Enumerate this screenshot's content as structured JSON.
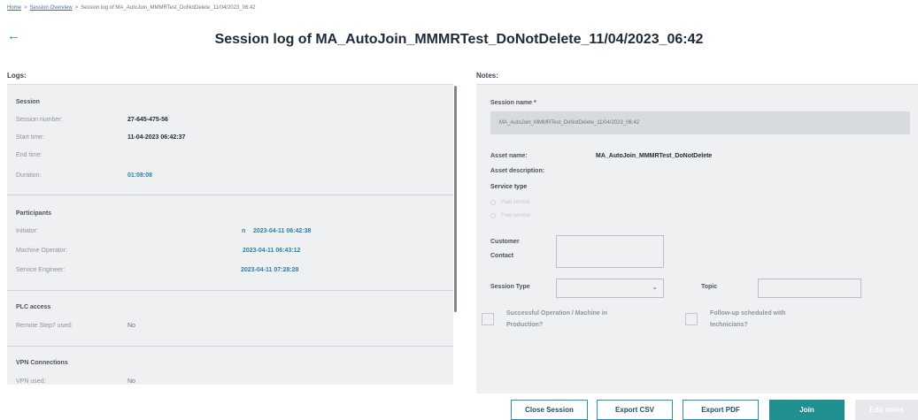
{
  "breadcrumb": {
    "home": "Home",
    "overview": "Session Overview",
    "current": "Session log of MA_AutoJoin_MMMRTest_DoNotDelete_11/04/2023_06:42"
  },
  "header": {
    "back_icon": "arrow-left-icon",
    "title": "Session log of MA_AutoJoin_MMMRTest_DoNotDelete_11/04/2023_06:42"
  },
  "logs": {
    "section_label": "Logs:",
    "session": {
      "title": "Session",
      "number_label": "Session number:",
      "number_value": "27-645-475-56",
      "start_label": "Start time:",
      "start_value": "11-04-2023 06:42:37",
      "end_label": "End time:",
      "end_value": "",
      "duration_label": "Duration:",
      "duration_value": "01:08:08"
    },
    "participants": {
      "title": "Participants",
      "items": [
        {
          "label": "Initiator:",
          "prefix": "n",
          "value": "2023-04-11 06:42:38"
        },
        {
          "label": "Machine Operator:",
          "prefix": "",
          "value": "2023-04-11 06:43:12"
        },
        {
          "label": "Service Engineer:",
          "prefix": "",
          "value": "2023-04-11 07:28:28"
        }
      ]
    },
    "plc": {
      "title": "PLC access",
      "label": "Remote Step7 used:",
      "value": "No"
    },
    "vpn": {
      "title": "VPN Connections",
      "label": "VPN used:",
      "value": "No"
    }
  },
  "notes": {
    "section_label": "Notes:",
    "session_name_label": "Session name *",
    "session_name_value": "MA_AutoJoin_MMMRTest_DoNotDelete_11/04/2023_06:42",
    "asset_name_label": "Asset name:",
    "asset_name_value": "MA_AutoJoin_MMMRTest_DoNotDelete",
    "asset_description_label": "Asset description:",
    "service_type_label": "Service type",
    "service_options": [
      "Paid service",
      "Free service"
    ],
    "customer_contact_label_1": "Customer",
    "customer_contact_label_2": "Contact",
    "session_type_label": "Session Type",
    "session_type_value": "",
    "topic_label": "Topic",
    "topic_value": "",
    "checkbox_successful_1": "Successful Operation / Machine in",
    "checkbox_successful_2": "Production?",
    "checkbox_followup_1": "Follow-up scheduled with",
    "checkbox_followup_2": "technicians?"
  },
  "buttons": {
    "close_session": "Close Session",
    "export_csv": "Export CSV",
    "export_pdf": "Export PDF",
    "join": "Join",
    "edit_notes": "Edit notes"
  },
  "colors": {
    "accent": "#2a8fb0",
    "primary_button": "#1f8f8f",
    "link_value": "#2c7fa8",
    "panel_bg": "#eef0f2"
  }
}
